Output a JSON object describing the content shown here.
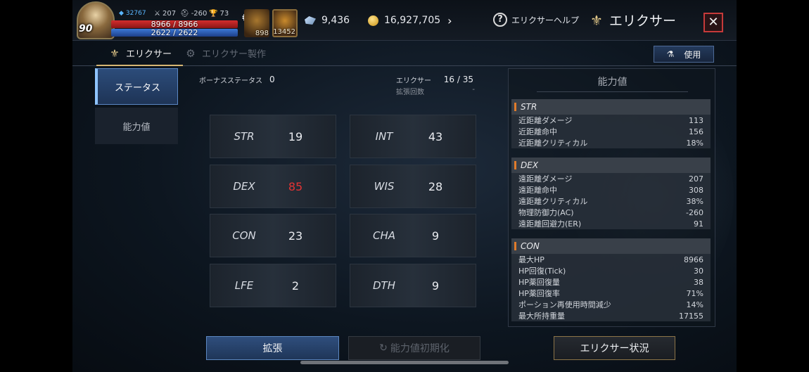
{
  "player": {
    "level": "90",
    "exp": "32767",
    "stat_a": "207",
    "stat_b": "-260",
    "stat_c": "73",
    "hp": "8966 / 8966",
    "mp": "2622 / 2622"
  },
  "items": [
    {
      "count": "898"
    },
    {
      "count": "13452"
    }
  ],
  "currency": {
    "gems": "9,436",
    "gold": "16,927,705"
  },
  "header": {
    "help_label": "エリクサーヘルプ",
    "title": "エリクサー",
    "close_icon": "✕"
  },
  "tabs": [
    {
      "label": "エリクサー",
      "active": true
    },
    {
      "label": "エリクサー製作",
      "active": false
    }
  ],
  "use_button": {
    "label": "使用"
  },
  "side_menu": [
    {
      "label": "ステータス",
      "active": true
    },
    {
      "label": "能力値",
      "active": false
    }
  ],
  "main": {
    "bonus_label": "ボーナスステータス",
    "bonus_value": "0",
    "elixir_label": "エリクサー",
    "elixir_value": "16 / 35",
    "expand_label": "拡張回数",
    "expand_value": "-"
  },
  "stats": [
    {
      "name": "STR",
      "value": "19",
      "highlight": false
    },
    {
      "name": "INT",
      "value": "43",
      "highlight": false
    },
    {
      "name": "DEX",
      "value": "85",
      "highlight": true
    },
    {
      "name": "WIS",
      "value": "28",
      "highlight": false
    },
    {
      "name": "CON",
      "value": "23",
      "highlight": false
    },
    {
      "name": "CHA",
      "value": "9",
      "highlight": false
    },
    {
      "name": "LFE",
      "value": "2",
      "highlight": false
    },
    {
      "name": "DTH",
      "value": "9",
      "highlight": false
    }
  ],
  "panel": {
    "title": "能力値",
    "groups": [
      {
        "name": "STR",
        "rows": [
          {
            "label": "近距離ダメージ",
            "value": "113"
          },
          {
            "label": "近距離命中",
            "value": "156"
          },
          {
            "label": "近距離クリティカル",
            "value": "18%"
          }
        ]
      },
      {
        "name": "DEX",
        "rows": [
          {
            "label": "遠距離ダメージ",
            "value": "207"
          },
          {
            "label": "遠距離命中",
            "value": "308"
          },
          {
            "label": "遠距離クリティカル",
            "value": "38%"
          },
          {
            "label": "物理防御力(AC)",
            "value": "-260"
          },
          {
            "label": "遠距離回避力(ER)",
            "value": "91"
          }
        ]
      },
      {
        "name": "CON",
        "rows": [
          {
            "label": "最大HP",
            "value": "8966"
          },
          {
            "label": "HP回復(Tick)",
            "value": "30"
          },
          {
            "label": "HP薬回復量",
            "value": "38"
          },
          {
            "label": "HP薬回復率",
            "value": "71%"
          },
          {
            "label": "ポーション再使用時間減少",
            "value": "14%"
          },
          {
            "label": "最大所持重量",
            "value": "17155"
          }
        ]
      }
    ]
  },
  "buttons": {
    "expand": "拡張",
    "reset": "能力値初期化",
    "status": "エリクサー状況"
  },
  "colors": {
    "accent_gold": "#d6b673",
    "highlight_red": "#e23434",
    "button_blue": "#2f4e7d"
  }
}
